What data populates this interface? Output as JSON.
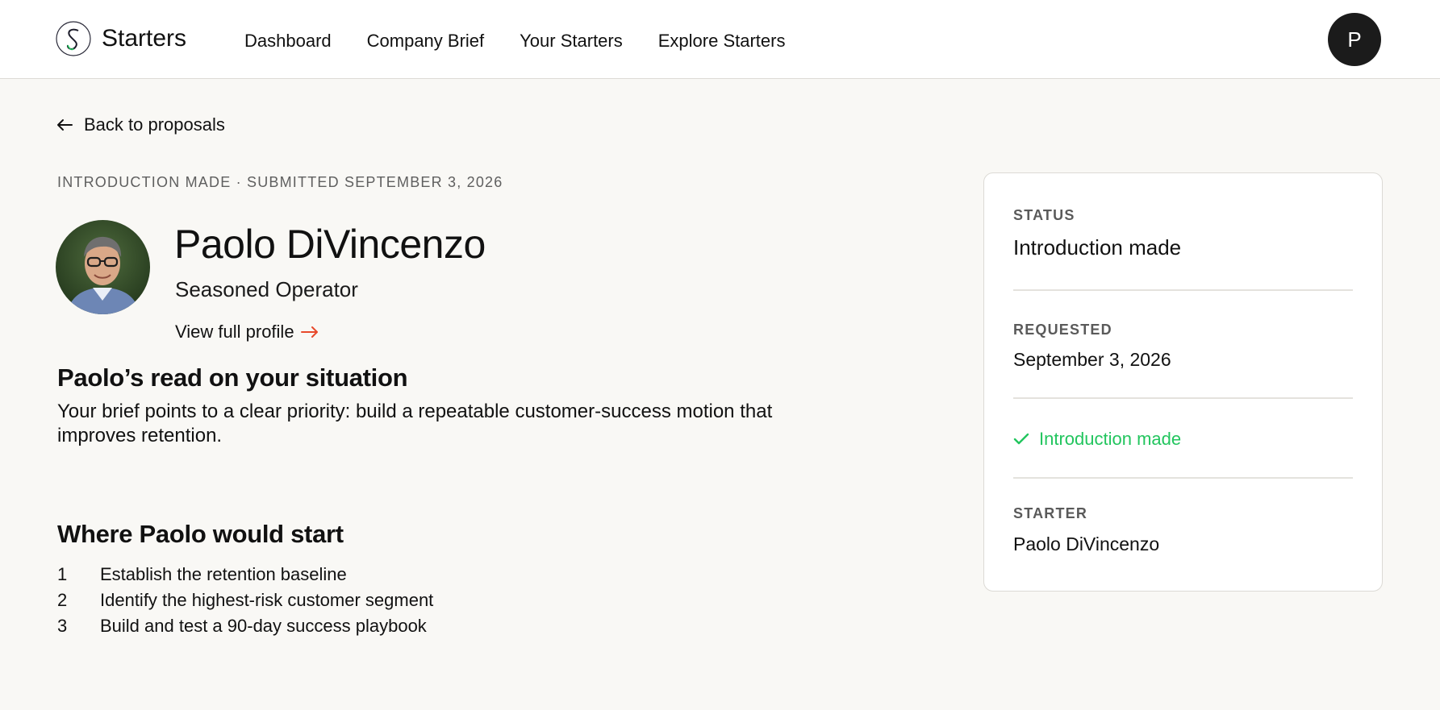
{
  "header": {
    "brand": "Starters",
    "nav": [
      "Dashboard",
      "Company Brief",
      "Your Starters",
      "Explore Starters"
    ],
    "avatar_initial": "P"
  },
  "back_link": "Back to proposals",
  "proposal": {
    "meta": "INTRODUCTION MADE · SUBMITTED SEPTEMBER 3, 2026",
    "name": "Paolo DiVincenzo",
    "role": "Seasoned Operator",
    "profile_link": "View full profile",
    "read_title": "Paolo’s read on your situation",
    "read_body": "Your brief points to a clear priority: build a repeatable customer-success motion that improves retention.",
    "start_title": "Where Paolo would start",
    "steps": [
      {
        "num": "1",
        "text": "Establish the retention baseline"
      },
      {
        "num": "2",
        "text": "Identify the highest-risk customer segment"
      },
      {
        "num": "3",
        "text": "Build and test a 90-day success playbook"
      }
    ]
  },
  "sidebar": {
    "status_label": "STATUS",
    "status_value": "Introduction made",
    "requested_label": "REQUESTED",
    "requested_value": "September 3, 2026",
    "badge": "Introduction made",
    "starter_label": "STARTER",
    "starter_value": "Paolo DiVincenzo"
  },
  "colors": {
    "accent": "#e8492b",
    "success": "#22c55e",
    "background": "#f9f8f5"
  }
}
